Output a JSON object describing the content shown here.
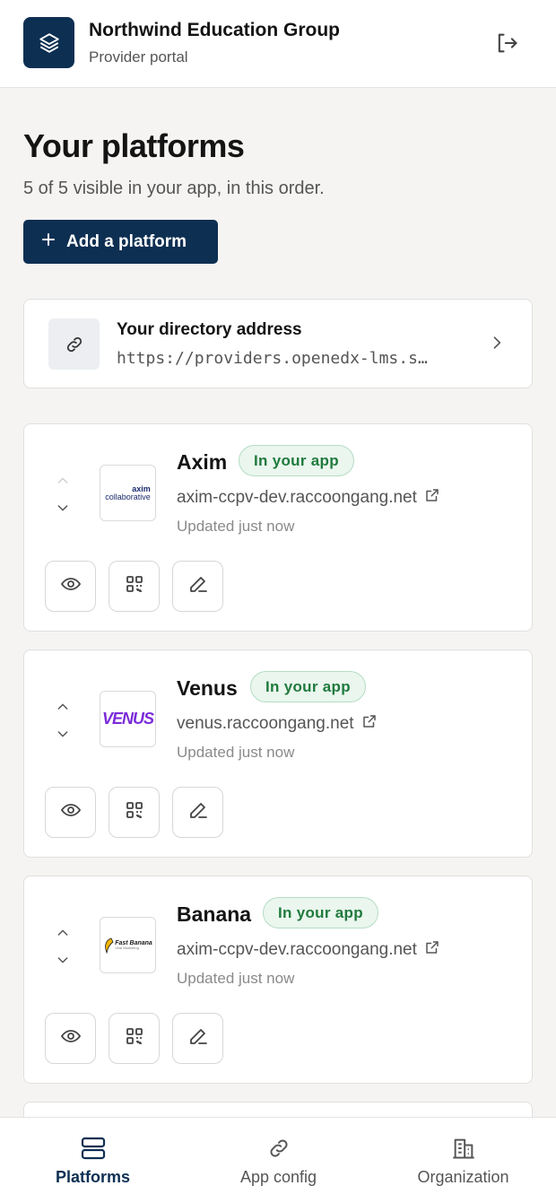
{
  "header": {
    "org_name": "Northwind Education Group",
    "subtitle": "Provider portal",
    "logo_icon": "layers-icon",
    "logout_icon": "logout-icon"
  },
  "page": {
    "title": "Your platforms",
    "subtitle": "5 of 5 visible in your app, in this order.",
    "add_button": "Add a platform"
  },
  "directory": {
    "title": "Your directory address",
    "url": "https://providers.openedx-lms.s…",
    "icon": "link-icon"
  },
  "platforms": [
    {
      "name": "Axim",
      "badge": "In your app",
      "url": "axim-ccpv-dev.raccoongang.net",
      "updated": "Updated just now",
      "logo_text_top": "axim",
      "logo_text_bottom": "collaborative",
      "can_move_up": false
    },
    {
      "name": "Venus",
      "badge": "In your app",
      "url": "venus.raccoongang.net",
      "updated": "Updated just now",
      "logo_text": "VENUS",
      "can_move_up": true
    },
    {
      "name": "Banana",
      "badge": "In your app",
      "url": "axim-ccpv-dev.raccoongang.net",
      "updated": "Updated just now",
      "logo_text": "Fast Banana",
      "logo_sub": "Viral Marketing",
      "can_move_up": true
    }
  ],
  "nav": {
    "items": [
      {
        "label": "Platforms",
        "icon": "server-icon",
        "active": true
      },
      {
        "label": "App config",
        "icon": "link-icon",
        "active": false
      },
      {
        "label": "Organization",
        "icon": "building-icon",
        "active": false
      }
    ]
  },
  "colors": {
    "primary": "#0d2f52",
    "badge_green": "#1f7a3d",
    "badge_bg": "#eaf6ee",
    "venus_purple": "#7b2bd9"
  }
}
